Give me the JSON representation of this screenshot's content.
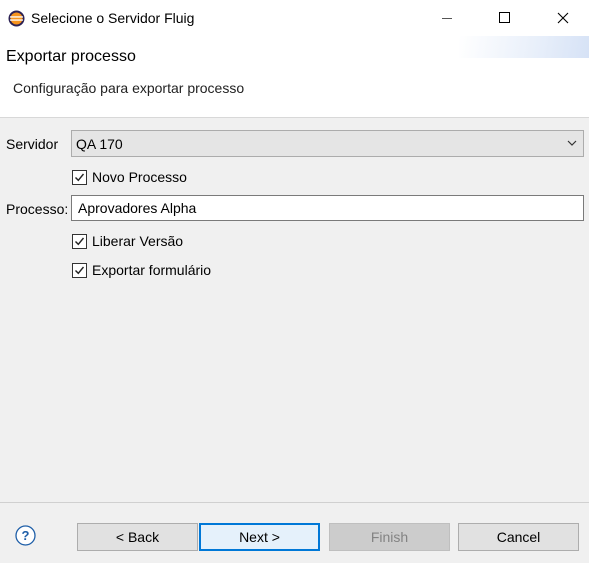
{
  "window": {
    "title": "Selecione o Servidor Fluig"
  },
  "header": {
    "title": "Exportar processo",
    "description": "Configuração para exportar processo"
  },
  "form": {
    "server_label": "Servidor",
    "server_value": "QA 170",
    "new_process_label": "Novo Processo",
    "new_process_checked": true,
    "process_label": "Processo:",
    "process_value": "Aprovadores Alpha",
    "release_version_label": "Liberar Versão",
    "release_version_checked": true,
    "export_form_label": "Exportar formulário",
    "export_form_checked": true
  },
  "buttons": {
    "back": "< Back",
    "next": "Next >",
    "finish": "Finish",
    "cancel": "Cancel"
  },
  "colors": {
    "accent": "#0078d7",
    "background": "#f0f0f0",
    "header_background": "#ffffff"
  },
  "icons": {
    "app": "eclipse-icon",
    "help": "help-icon"
  }
}
